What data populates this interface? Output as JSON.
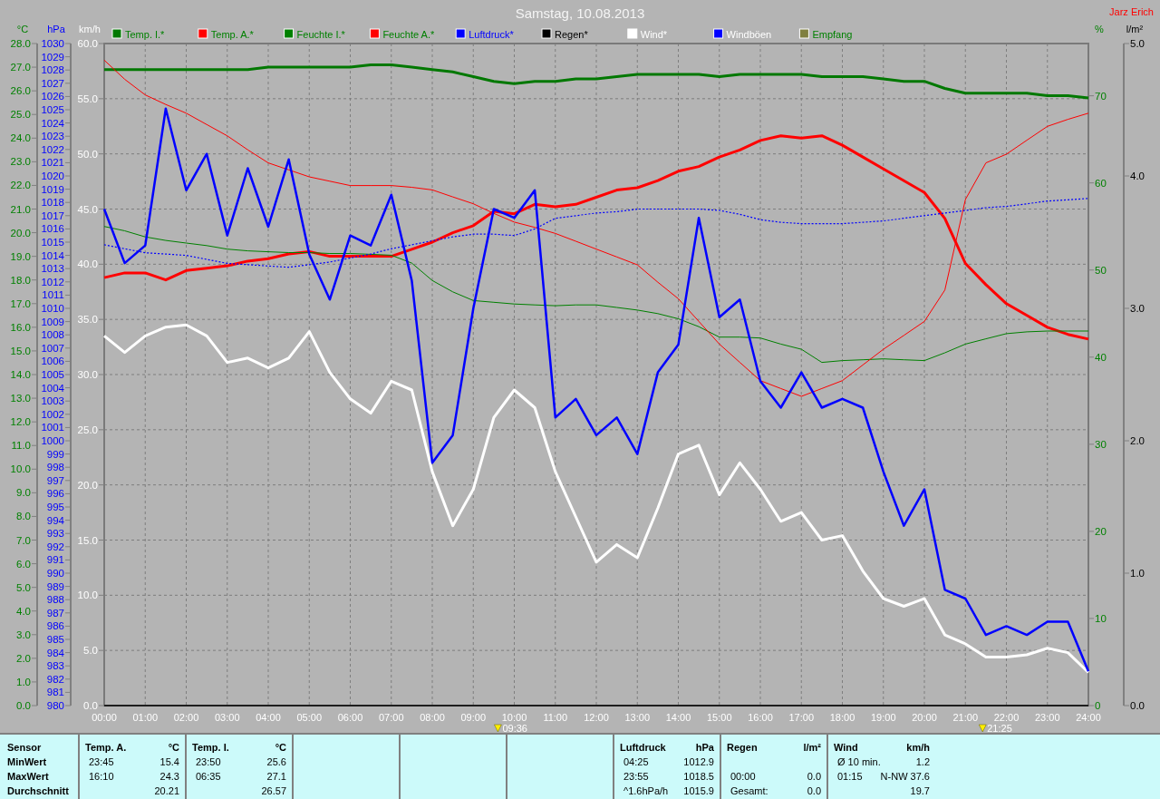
{
  "header": {
    "title": "Samstag, 10.08.2013",
    "user": "Jarz Erich"
  },
  "chart": {
    "chart_data": {
      "type": "line",
      "x": [
        0,
        0.5,
        1,
        1.5,
        2,
        2.5,
        3,
        3.5,
        4,
        4.5,
        5,
        5.5,
        6,
        6.5,
        7,
        7.5,
        8,
        8.5,
        9,
        9.5,
        10,
        10.5,
        11,
        11.5,
        12,
        12.5,
        13,
        13.5,
        14,
        14.5,
        15,
        15.5,
        16,
        16.5,
        17,
        17.5,
        18,
        18.5,
        19,
        19.5,
        20,
        20.5,
        21,
        21.5,
        22,
        22.5,
        23,
        23.5,
        24
      ],
      "xlim": [
        0,
        24
      ],
      "xticks": [
        {
          "value": 0,
          "label": "00:00"
        },
        {
          "value": 1,
          "label": "01:00"
        },
        {
          "value": 2,
          "label": "02:00"
        },
        {
          "value": 3,
          "label": "03:00"
        },
        {
          "value": 4,
          "label": "04:00"
        },
        {
          "value": 5,
          "label": "05:00"
        },
        {
          "value": 6,
          "label": "06:00"
        },
        {
          "value": 7,
          "label": "07:00"
        },
        {
          "value": 8,
          "label": "08:00"
        },
        {
          "value": 9,
          "label": "09:00"
        },
        {
          "value": 10,
          "label": "10:00"
        },
        {
          "value": 11,
          "label": "11:00"
        },
        {
          "value": 12,
          "label": "12:00"
        },
        {
          "value": 13,
          "label": "13:00"
        },
        {
          "value": 14,
          "label": "14:00"
        },
        {
          "value": 15,
          "label": "15:00"
        },
        {
          "value": 16,
          "label": "16:00"
        },
        {
          "value": 17,
          "label": "17:00"
        },
        {
          "value": 18,
          "label": "18:00"
        },
        {
          "value": 19,
          "label": "19:00"
        },
        {
          "value": 20,
          "label": "20:00"
        },
        {
          "value": 21,
          "label": "21:00"
        },
        {
          "value": 22,
          "label": "22:00"
        },
        {
          "value": 23,
          "label": "23:00"
        },
        {
          "value": 24,
          "label": "24:00"
        }
      ],
      "ylabel": "km/h",
      "ylim": [
        0,
        60
      ],
      "yticks": [
        {
          "value": 0,
          "label": "0.0"
        },
        {
          "value": 5,
          "label": "5.0"
        },
        {
          "value": 10,
          "label": "10.0"
        },
        {
          "value": 15,
          "label": "15.0"
        },
        {
          "value": 20,
          "label": "20.0"
        },
        {
          "value": 25,
          "label": "25.0"
        },
        {
          "value": 30,
          "label": "30.0"
        },
        {
          "value": 35,
          "label": "35.0"
        },
        {
          "value": 40,
          "label": "40.0"
        },
        {
          "value": 45,
          "label": "45.0"
        },
        {
          "value": 50,
          "label": "50.0"
        },
        {
          "value": 55,
          "label": "55.0"
        },
        {
          "value": 60,
          "label": "60.0"
        }
      ],
      "y2label": "°C",
      "y2lim": [
        0,
        28
      ],
      "y2ticks": [
        {
          "value": 0,
          "label": "0.0"
        },
        {
          "value": 1,
          "label": "1.0"
        },
        {
          "value": 2,
          "label": "2.0"
        },
        {
          "value": 3,
          "label": "3.0"
        },
        {
          "value": 4,
          "label": "4.0"
        },
        {
          "value": 5,
          "label": "5.0"
        },
        {
          "value": 6,
          "label": "6.0"
        },
        {
          "value": 7,
          "label": "7.0"
        },
        {
          "value": 8,
          "label": "8.0"
        },
        {
          "value": 9,
          "label": "9.0"
        },
        {
          "value": 10,
          "label": "10.0"
        },
        {
          "value": 11,
          "label": "11.0"
        },
        {
          "value": 12,
          "label": "12.0"
        },
        {
          "value": 13,
          "label": "13.0"
        },
        {
          "value": 14,
          "label": "14.0"
        },
        {
          "value": 15,
          "label": "15.0"
        },
        {
          "value": 16,
          "label": "16.0"
        },
        {
          "value": 17,
          "label": "17.0"
        },
        {
          "value": 18,
          "label": "18.0"
        },
        {
          "value": 19,
          "label": "19.0"
        },
        {
          "value": 20,
          "label": "20.0"
        },
        {
          "value": 21,
          "label": "21.0"
        },
        {
          "value": 22,
          "label": "22.0"
        },
        {
          "value": 23,
          "label": "23.0"
        },
        {
          "value": 24,
          "label": "24.0"
        },
        {
          "value": 25,
          "label": "25.0"
        },
        {
          "value": 26,
          "label": "26.0"
        },
        {
          "value": 27,
          "label": "27.0"
        },
        {
          "value": 28,
          "label": "28.0"
        }
      ],
      "y3label": "%",
      "y3lim": [
        0,
        76
      ],
      "y3ticks": [
        {
          "value": 0,
          "label": "0"
        },
        {
          "value": 10,
          "label": "10"
        },
        {
          "value": 20,
          "label": "20"
        },
        {
          "value": 30,
          "label": "30"
        },
        {
          "value": 40,
          "label": "40"
        },
        {
          "value": 50,
          "label": "50"
        },
        {
          "value": 60,
          "label": "60"
        },
        {
          "value": 70,
          "label": "70"
        }
      ],
      "series": [
        {
          "name": "Temp. I.*",
          "color": "#007800",
          "axis": "y2",
          "values": [
            26.9,
            26.9,
            26.9,
            26.9,
            26.9,
            26.9,
            26.9,
            26.9,
            27.0,
            27.0,
            27.0,
            27.0,
            27.0,
            27.1,
            27.1,
            27.0,
            26.9,
            26.8,
            26.6,
            26.4,
            26.3,
            26.4,
            26.4,
            26.5,
            26.5,
            26.6,
            26.7,
            26.7,
            26.7,
            26.7,
            26.6,
            26.7,
            26.7,
            26.7,
            26.7,
            26.6,
            26.6,
            26.6,
            26.5,
            26.4,
            26.4,
            26.1,
            25.9,
            25.9,
            25.9,
            25.9,
            25.8,
            25.8,
            25.7
          ]
        },
        {
          "name": "Temp. A.*",
          "color": "#ff0000",
          "axis": "y2",
          "values": [
            18.1,
            18.3,
            18.3,
            18.0,
            18.4,
            18.5,
            18.6,
            18.8,
            18.9,
            19.1,
            19.2,
            19.0,
            19.0,
            19.0,
            19.0,
            19.3,
            19.6,
            20.0,
            20.3,
            20.9,
            20.8,
            21.2,
            21.1,
            21.2,
            21.5,
            21.8,
            21.9,
            22.2,
            22.6,
            22.8,
            23.2,
            23.5,
            23.9,
            24.1,
            24.0,
            24.1,
            23.7,
            23.2,
            22.7,
            22.2,
            21.7,
            20.6,
            18.7,
            17.8,
            17.0,
            16.5,
            16.0,
            15.7,
            15.5
          ]
        },
        {
          "name": "Feuchte I.*",
          "color": "#008000",
          "axis": "y3",
          "values": [
            55.0,
            54.5,
            53.8,
            53.4,
            53.1,
            52.8,
            52.4,
            52.2,
            52.1,
            52.0,
            52.0,
            51.9,
            51.9,
            51.8,
            51.7,
            50.8,
            48.8,
            47.5,
            46.5,
            46.3,
            46.1,
            46.0,
            45.9,
            46.0,
            46.0,
            45.7,
            45.4,
            45.0,
            44.4,
            43.5,
            42.3,
            42.3,
            42.2,
            41.5,
            40.9,
            39.4,
            39.6,
            39.7,
            39.8,
            39.7,
            39.6,
            40.5,
            41.5,
            42.1,
            42.7,
            42.9,
            43.0,
            43.0,
            43.0
          ]
        },
        {
          "name": "Feuchte A.*",
          "color": "#ff0000",
          "axis": "y3",
          "values": [
            74.1,
            71.9,
            70.1,
            69.0,
            68.0,
            66.7,
            65.4,
            63.8,
            62.3,
            61.5,
            60.7,
            60.2,
            59.7,
            59.7,
            59.7,
            59.5,
            59.2,
            58.4,
            57.6,
            56.5,
            55.5,
            54.9,
            54.2,
            53.3,
            52.4,
            51.5,
            50.6,
            48.6,
            46.7,
            44.1,
            41.5,
            39.4,
            37.3,
            36.4,
            35.5,
            36.4,
            37.3,
            39.1,
            40.9,
            42.5,
            44.1,
            47.7,
            58.1,
            62.3,
            63.3,
            64.9,
            66.5,
            67.3,
            68.0
          ]
        },
        {
          "name": "Wind*",
          "color": "#ffffff",
          "values": [
            33.5,
            32.0,
            33.5,
            34.3,
            34.5,
            33.5,
            31.1,
            31.5,
            30.6,
            31.5,
            33.9,
            30.2,
            27.8,
            26.5,
            29.4,
            28.6,
            21.2,
            16.3,
            19.6,
            26.1,
            28.6,
            27.0,
            21.2,
            17.1,
            13.0,
            14.6,
            13.4,
            17.9,
            22.8,
            23.6,
            19.1,
            22.0,
            19.6,
            16.7,
            17.5,
            15.0,
            15.4,
            12.2,
            9.7,
            9.0,
            9.7,
            6.4,
            5.6,
            4.4,
            4.4,
            4.6,
            5.2,
            4.8,
            3.0
          ]
        },
        {
          "name": "Windböen",
          "color": "#0000ff",
          "values": [
            45.0,
            40.1,
            41.7,
            54.1,
            46.7,
            50.0,
            42.6,
            48.7,
            43.4,
            49.5,
            40.9,
            36.8,
            42.6,
            41.7,
            46.3,
            38.5,
            22.0,
            24.5,
            36.0,
            45.0,
            44.2,
            46.7,
            26.1,
            27.8,
            24.5,
            26.1,
            22.8,
            30.2,
            32.7,
            44.2,
            35.2,
            36.8,
            29.4,
            27.0,
            30.2,
            27.0,
            27.8,
            27.0,
            21.2,
            16.3,
            19.6,
            10.5,
            9.7,
            6.4,
            7.2,
            6.4,
            7.6,
            7.6,
            3.1
          ]
        },
        {
          "name": "Empfang",
          "color": "#808040",
          "axis": "y3",
          "values": [
            null,
            null,
            null,
            null,
            null,
            null,
            null,
            null,
            null,
            null,
            null,
            null,
            null,
            null,
            null,
            null,
            null,
            null,
            null,
            null,
            null,
            null,
            null,
            null,
            null,
            null,
            null,
            null,
            null,
            null,
            null,
            null,
            null,
            null,
            null,
            null,
            null,
            null,
            null,
            null,
            null,
            null,
            null,
            null,
            null,
            null,
            null,
            null,
            null
          ]
        }
      ],
      "grid": true,
      "legend": "top"
    },
    "markers": [
      "09:36",
      "21:25"
    ]
  },
  "pressure_chart": {
    "chart_data": {
      "type": "line",
      "x": [
        0,
        0.5,
        1,
        1.5,
        2,
        2.5,
        3,
        3.5,
        4,
        4.5,
        5,
        5.5,
        6,
        6.5,
        7,
        7.5,
        8,
        8.5,
        9,
        9.5,
        10,
        10.5,
        11,
        11.5,
        12,
        12.5,
        13,
        13.5,
        14,
        14.5,
        15,
        15.5,
        16,
        16.5,
        17,
        17.5,
        18,
        18.5,
        19,
        19.5,
        20,
        20.5,
        21,
        21.5,
        22,
        22.5,
        23,
        23.5,
        24
      ],
      "xlim": [
        0,
        24
      ],
      "ylabel": "hPa",
      "ylim": [
        980,
        1030
      ],
      "yticks": [
        {
          "value": 980,
          "label": "980"
        },
        {
          "value": 981,
          "label": "981"
        },
        {
          "value": 982,
          "label": "982"
        },
        {
          "value": 983,
          "label": "983"
        },
        {
          "value": 984,
          "label": "984"
        },
        {
          "value": 985,
          "label": "985"
        },
        {
          "value": 986,
          "label": "986"
        },
        {
          "value": 987,
          "label": "987"
        },
        {
          "value": 988,
          "label": "988"
        },
        {
          "value": 989,
          "label": "989"
        },
        {
          "value": 990,
          "label": "990"
        },
        {
          "value": 991,
          "label": "991"
        },
        {
          "value": 992,
          "label": "992"
        },
        {
          "value": 993,
          "label": "993"
        },
        {
          "value": 994,
          "label": "994"
        },
        {
          "value": 995,
          "label": "995"
        },
        {
          "value": 996,
          "label": "996"
        },
        {
          "value": 997,
          "label": "997"
        },
        {
          "value": 998,
          "label": "998"
        },
        {
          "value": 999,
          "label": "999"
        },
        {
          "value": 1000,
          "label": "1000"
        },
        {
          "value": 1001,
          "label": "1001"
        },
        {
          "value": 1002,
          "label": "1002"
        },
        {
          "value": 1003,
          "label": "1003"
        },
        {
          "value": 1004,
          "label": "1004"
        },
        {
          "value": 1005,
          "label": "1005"
        },
        {
          "value": 1006,
          "label": "1006"
        },
        {
          "value": 1007,
          "label": "1007"
        },
        {
          "value": 1008,
          "label": "1008"
        },
        {
          "value": 1009,
          "label": "1009"
        },
        {
          "value": 1010,
          "label": "1010"
        },
        {
          "value": 1011,
          "label": "1011"
        },
        {
          "value": 1012,
          "label": "1012"
        },
        {
          "value": 1013,
          "label": "1013"
        },
        {
          "value": 1014,
          "label": "1014"
        },
        {
          "value": 1015,
          "label": "1015"
        },
        {
          "value": 1016,
          "label": "1016"
        },
        {
          "value": 1017,
          "label": "1017"
        },
        {
          "value": 1018,
          "label": "1018"
        },
        {
          "value": 1019,
          "label": "1019"
        },
        {
          "value": 1020,
          "label": "1020"
        },
        {
          "value": 1021,
          "label": "1021"
        },
        {
          "value": 1022,
          "label": "1022"
        },
        {
          "value": 1023,
          "label": "1023"
        },
        {
          "value": 1024,
          "label": "1024"
        },
        {
          "value": 1025,
          "label": "1025"
        },
        {
          "value": 1026,
          "label": "1026"
        },
        {
          "value": 1027,
          "label": "1027"
        },
        {
          "value": 1028,
          "label": "1028"
        },
        {
          "value": 1029,
          "label": "1029"
        },
        {
          "value": 1030,
          "label": "1030"
        }
      ],
      "y2label": "l/m²",
      "y2lim": [
        0,
        5
      ],
      "y2ticks": [
        {
          "value": 0,
          "label": "0.0"
        },
        {
          "value": 1,
          "label": "1.0"
        },
        {
          "value": 2,
          "label": "2.0"
        },
        {
          "value": 3,
          "label": "3.0"
        },
        {
          "value": 4,
          "label": "4.0"
        },
        {
          "value": 5,
          "label": "5.0"
        }
      ],
      "series": [
        {
          "name": "Luftdruck*",
          "color": "#0000ff",
          "line_style": "dotted",
          "values": [
            1014.8,
            1014.5,
            1014.2,
            1014.1,
            1014.0,
            1013.7,
            1013.4,
            1013.3,
            1013.2,
            1013.1,
            1013.3,
            1013.5,
            1013.8,
            1014.1,
            1014.5,
            1014.8,
            1015.1,
            1015.4,
            1015.6,
            1015.6,
            1015.5,
            1016.0,
            1016.8,
            1017.0,
            1017.2,
            1017.3,
            1017.5,
            1017.5,
            1017.5,
            1017.5,
            1017.4,
            1017.1,
            1016.7,
            1016.5,
            1016.4,
            1016.4,
            1016.4,
            1016.5,
            1016.6,
            1016.8,
            1017.0,
            1017.2,
            1017.4,
            1017.6,
            1017.7,
            1017.9,
            1018.1,
            1018.2,
            1018.3
          ]
        },
        {
          "name": "Regen*",
          "color": "#000000",
          "axis": "y2",
          "values": [
            0.0,
            0.0,
            0.0,
            0.0,
            0.0,
            0.0,
            0.0,
            0.0,
            0.0,
            0.0,
            0.0,
            0.0,
            0.0,
            0.0,
            0.0,
            0.0,
            0.0,
            0.0,
            0.0,
            0.0,
            0.0,
            0.0,
            0.0,
            0.0,
            0.0,
            0.0,
            0.0,
            0.0,
            0.0,
            0.0,
            0.0,
            0.0,
            0.0,
            0.0,
            0.0,
            0.0,
            0.0,
            0.0,
            0.0,
            0.0,
            0.0,
            0.0,
            0.0,
            0.0,
            0.0,
            0.0,
            0.0,
            0.0,
            0.0
          ]
        }
      ]
    }
  },
  "summary": {
    "labels": {
      "heading": "Sensor",
      "rows": [
        "MinWert",
        "MaxWert",
        "Durchschnitt"
      ]
    },
    "columns": [
      {
        "kind": "sensor",
        "heading": "Temp. A.",
        "unit": "°C",
        "rows": [
          {
            "time": "23:45",
            "value": "15.4"
          },
          {
            "time": "16:10",
            "value": "24.3"
          },
          {
            "value": "20.21"
          }
        ]
      },
      {
        "kind": "sensor",
        "heading": "Temp. I.",
        "unit": "°C",
        "rows": [
          {
            "time": "23:50",
            "value": "25.6"
          },
          {
            "time": "06:35",
            "value": "27.1"
          },
          {
            "value": "26.57"
          }
        ]
      },
      {
        "kind": "empty"
      },
      {
        "kind": "empty"
      },
      {
        "kind": "empty"
      },
      {
        "kind": "sensor",
        "heading": "Luftdruck",
        "unit": "hPa",
        "rows": [
          {
            "time": "04:25",
            "value": "1012.9"
          },
          {
            "time": "23:55",
            "value": "1018.5"
          },
          {
            "time": "^1.6hPa/h",
            "value": "1015.9"
          }
        ]
      },
      {
        "kind": "sensor",
        "heading": "Regen",
        "unit": "l/m²",
        "rows": [
          {},
          {
            "time": "00:00",
            "value": "0.0"
          },
          {
            "time": "Gesamt:",
            "value": "0.0"
          }
        ]
      },
      {
        "kind": "sensor",
        "heading": "Wind",
        "unit": "km/h",
        "rows": [
          {
            "time": "Ø 10 min.",
            "value": "1.2"
          },
          {
            "time": "01:15",
            "value": "N-NW 37.6"
          },
          {
            "value": "19.7"
          }
        ]
      }
    ]
  }
}
